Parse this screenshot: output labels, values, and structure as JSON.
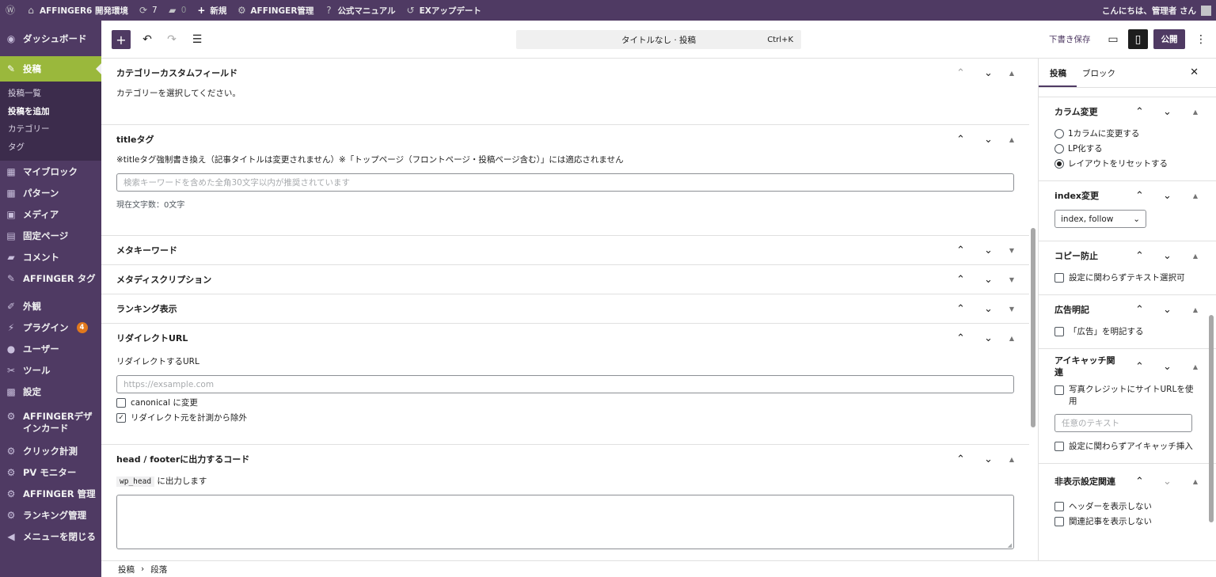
{
  "adminbar": {
    "site_name": "AFFINGER6 開発環境",
    "updates_count": "7",
    "comments_count": "0",
    "new_label": "新規",
    "affinger_admin": "AFFINGER管理",
    "manual": "公式マニュアル",
    "ex_update": "EXアップデート",
    "greeting": "こんにちは、管理者 さん"
  },
  "sidebar": {
    "dashboard": "ダッシュボード",
    "posts": "投稿",
    "sub": [
      "投稿一覧",
      "投稿を追加",
      "カテゴリー",
      "タグ"
    ],
    "items": [
      {
        "label": "マイブロック"
      },
      {
        "label": "パターン"
      },
      {
        "label": "メディア"
      },
      {
        "label": "固定ページ"
      },
      {
        "label": "コメント"
      },
      {
        "label": "AFFINGER タグ"
      }
    ],
    "items2": [
      {
        "label": "外観"
      },
      {
        "label": "プラグイン",
        "badge": "4"
      },
      {
        "label": "ユーザー"
      },
      {
        "label": "ツール"
      },
      {
        "label": "設定"
      }
    ],
    "items3": [
      {
        "label": "AFFINGERデザインカード"
      },
      {
        "label": "クリック計測"
      },
      {
        "label": "PV モニター"
      },
      {
        "label": "AFFINGER 管理"
      },
      {
        "label": "ランキング管理"
      },
      {
        "label": "メニューを閉じる"
      }
    ]
  },
  "header": {
    "document_title": "タイトルなし · 投稿",
    "shortcut": "Ctrl+K",
    "save_draft": "下書き保存",
    "publish": "公開"
  },
  "main": {
    "category_fields": {
      "title": "カテゴリーカスタムフィールド",
      "text": "カテゴリーを選択してください。"
    },
    "title_tag": {
      "title": "titleタグ",
      "note": "※titleタグ強制書き換え（記事タイトルは変更されません）※「トップページ（フロントページ・投稿ページ含む）」には適応されません",
      "placeholder": "検索キーワードを含めた全角30文字以内が推奨されています",
      "count": "現在文字数：0文字"
    },
    "meta_keywords": "メタキーワード",
    "meta_description": "メタディスクリプション",
    "ranking": "ランキング表示",
    "redirect": {
      "title": "リダイレクトURL",
      "label": "リダイレクトするURL",
      "placeholder": "https://exsample.com",
      "canonical": "canonical に変更",
      "exclude": "リダイレクト元を計測から除外"
    },
    "head_footer": {
      "title": "head / footerに出力するコード",
      "code": "wp_head",
      "suffix": "に出力します"
    }
  },
  "breadcrumb": [
    "投稿",
    "段落"
  ],
  "settings": {
    "tabs": [
      "投稿",
      "ブロック"
    ],
    "column": {
      "title": "カラム変更",
      "options": [
        "1カラムに変更する",
        "LP化する",
        "レイアウトをリセットする"
      ],
      "selected": 2
    },
    "index": {
      "title": "index変更",
      "value": "index, follow"
    },
    "copy": {
      "title": "コピー防止",
      "checkbox": "設定に関わらずテキスト選択可"
    },
    "ad": {
      "title": "広告明記",
      "checkbox": "「広告」を明記する"
    },
    "eyecatch": {
      "title": "アイキャッチ関連",
      "checkbox": "写真クレジットにサイトURLを使用",
      "placeholder": "任意のテキスト",
      "checkbox2": "設定に関わらずアイキャッチ挿入"
    },
    "hidden": {
      "title": "非表示設定関連",
      "options": [
        "ヘッダーを表示しない",
        "関連記事を表示しない"
      ]
    }
  }
}
